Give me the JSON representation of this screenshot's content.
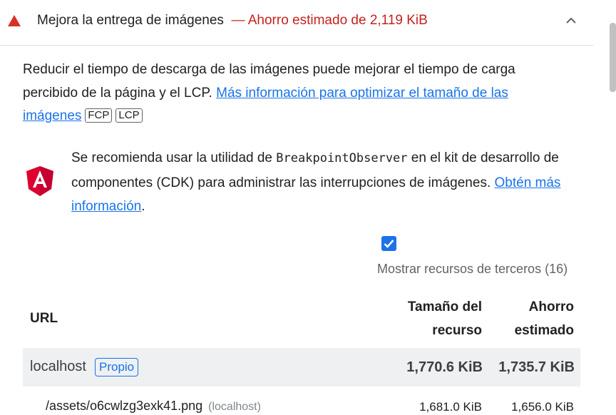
{
  "audit": {
    "title": "Mejora la entrega de imágenes",
    "savings": "— Ahorro estimado de 2,119 KiB",
    "status_color": "#d93025",
    "accent_color": "#1a73e8"
  },
  "description": {
    "text": "Reducir el tiempo de descarga de las imágenes puede mejorar el tiempo de carga percibido de la página y el LCP. ",
    "link": "Más información para optimizar el tamaño de las imágenes",
    "metrics": [
      "FCP",
      "LCP"
    ]
  },
  "stack_pack": {
    "icon": "angular-icon",
    "text_before": "Se recomienda usar la utilidad de ",
    "code": "BreakpointObserver",
    "text_after": " en el kit de desarrollo de componentes (CDK) para administrar las interrupciones de imágenes. ",
    "link": "Obtén más información",
    "trailing": "."
  },
  "third_party": {
    "checked": true,
    "label": "Mostrar recursos de terceros (16)"
  },
  "table": {
    "headers": {
      "url": "URL",
      "size_line1": "Tamaño del",
      "size_line2": "recurso",
      "savings_line1": "Ahorro",
      "savings_line2": "estimado"
    },
    "group": {
      "host": "localhost",
      "badge": "Propio",
      "size": "1,770.6 KiB",
      "savings": "1,735.7 KiB"
    },
    "rows": [
      {
        "url": "/assets/o6cwlzg3exk41.png",
        "host": "(localhost)",
        "size": "1,681.0 KiB",
        "savings": "1,656.0 KiB"
      }
    ]
  }
}
